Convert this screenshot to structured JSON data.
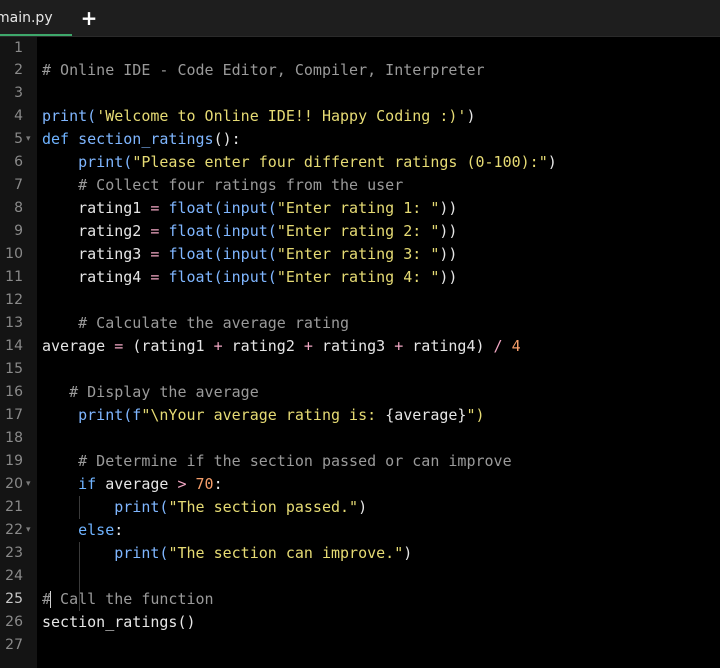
{
  "tab": {
    "label": "main.py",
    "add_label": "+"
  },
  "colors": {
    "background": "#000000",
    "gutter": "#141414",
    "comment": "#9a9a9a",
    "string": "#e6db74",
    "keyword": "#6fb3ff",
    "operator": "#f0a6c2",
    "number": "#f59e6a"
  },
  "fold_icon": "▾",
  "lines": [
    {
      "num": "1"
    },
    {
      "num": "2",
      "comment": "# Online IDE - Code Editor, Compiler, Interpreter"
    },
    {
      "num": "3"
    },
    {
      "num": "4",
      "fn": "print(",
      "str": "'Welcome to Online IDE!! Happy Coding :)'",
      "close": ")"
    },
    {
      "num": "5",
      "kw": "def",
      "fn": "section_ratings",
      "close": "():"
    },
    {
      "num": "6",
      "indent": "    ",
      "fn": "print(",
      "str": "\"Please enter four different ratings (0-100):\"",
      "close": ")"
    },
    {
      "num": "7",
      "indent": "    ",
      "comment": "# Collect four ratings from the user"
    },
    {
      "num": "8",
      "indent": "    ",
      "var": "rating1",
      "op": " = ",
      "fn": "float(input(",
      "str": "\"Enter rating 1: \"",
      "close": "))"
    },
    {
      "num": "9",
      "indent": "    ",
      "var": "rating2",
      "op": " = ",
      "fn": "float(input(",
      "str": "\"Enter rating 2: \"",
      "close": "))"
    },
    {
      "num": "10",
      "indent": "    ",
      "var": "rating3",
      "op": " = ",
      "fn": "float(input(",
      "str": "\"Enter rating 3: \"",
      "close": "))"
    },
    {
      "num": "11",
      "indent": "    ",
      "var": "rating4",
      "op": " = ",
      "fn": "float(input(",
      "str": "\"Enter rating 4: \"",
      "close": "))"
    },
    {
      "num": "12"
    },
    {
      "num": "13",
      "indent": "    ",
      "comment": "# Calculate the average rating"
    },
    {
      "num": "14",
      "indent": "    ",
      "text": "average = (rating1 + rating2 + rating3 + rating4) / 4"
    },
    {
      "num": "15"
    },
    {
      "num": "16",
      "indent": "   ",
      "comment": "# Display the average"
    },
    {
      "num": "17",
      "indent": "    ",
      "fn": "print(f",
      "str": "\"\\nYour average rating is: ",
      "var": "{average}",
      "close": "\")"
    },
    {
      "num": "18"
    },
    {
      "num": "19",
      "indent": "    ",
      "comment": "# Determine if the section passed or can improve"
    },
    {
      "num": "20",
      "indent": "    ",
      "kw": "if",
      "text": " average > 70:"
    },
    {
      "num": "21",
      "indent": "        ",
      "fn": "print(",
      "str": "\"The section passed.\"",
      "close": ")"
    },
    {
      "num": "22",
      "indent": "    ",
      "kw": "else",
      "close": ":"
    },
    {
      "num": "23",
      "indent": "        ",
      "fn": "print(",
      "str": "\"The section can improve.\"",
      "close": ")"
    },
    {
      "num": "24"
    },
    {
      "num": "25",
      "comment": "# Call the function"
    },
    {
      "num": "26",
      "text": "section_ratings()"
    },
    {
      "num": "27"
    }
  ]
}
